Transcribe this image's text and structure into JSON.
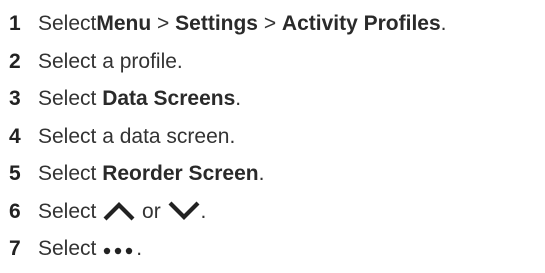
{
  "steps": [
    {
      "number": "1",
      "parts": {
        "t1": "Select ",
        "b1": "Menu",
        "t2": " > ",
        "b2": "Settings",
        "t3": " > ",
        "b3": "Activity Profiles",
        "t4": "."
      }
    },
    {
      "number": "2",
      "parts": {
        "t1": "Select a profile."
      }
    },
    {
      "number": "3",
      "parts": {
        "t1": "Select ",
        "b1": "Data Screens",
        "t2": "."
      }
    },
    {
      "number": "4",
      "parts": {
        "t1": "Select a data screen."
      }
    },
    {
      "number": "5",
      "parts": {
        "t1": "Select ",
        "b1": "Reorder Screen",
        "t2": "."
      }
    },
    {
      "number": "6",
      "parts": {
        "t1": "Select ",
        "icon1": "chevron-up-icon",
        "t2": " or ",
        "icon2": "chevron-down-icon",
        "t3": "."
      }
    },
    {
      "number": "7",
      "parts": {
        "t1": "Select ",
        "icon1": "more-options-icon",
        "t2": "."
      }
    }
  ]
}
